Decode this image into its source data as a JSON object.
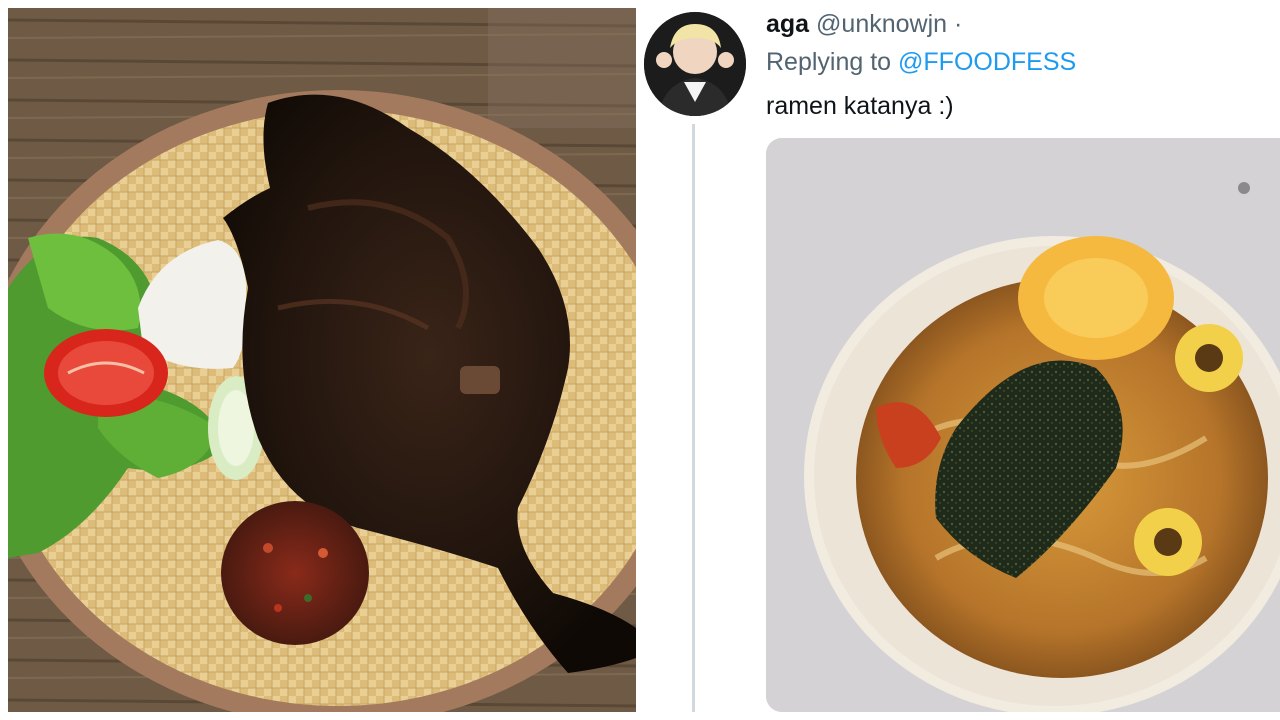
{
  "tweet": {
    "display_name": "aga",
    "handle": "@unknowjn",
    "separator": "·",
    "replying_to_label": "Replying to",
    "replying_to_handle": "@FFOODFESS",
    "text": "ramen katanya :)"
  },
  "icons": {
    "avatar": "user-avatar"
  },
  "colors": {
    "link": "#1d9bf0",
    "name": "#0f1419",
    "muted": "#536471"
  }
}
